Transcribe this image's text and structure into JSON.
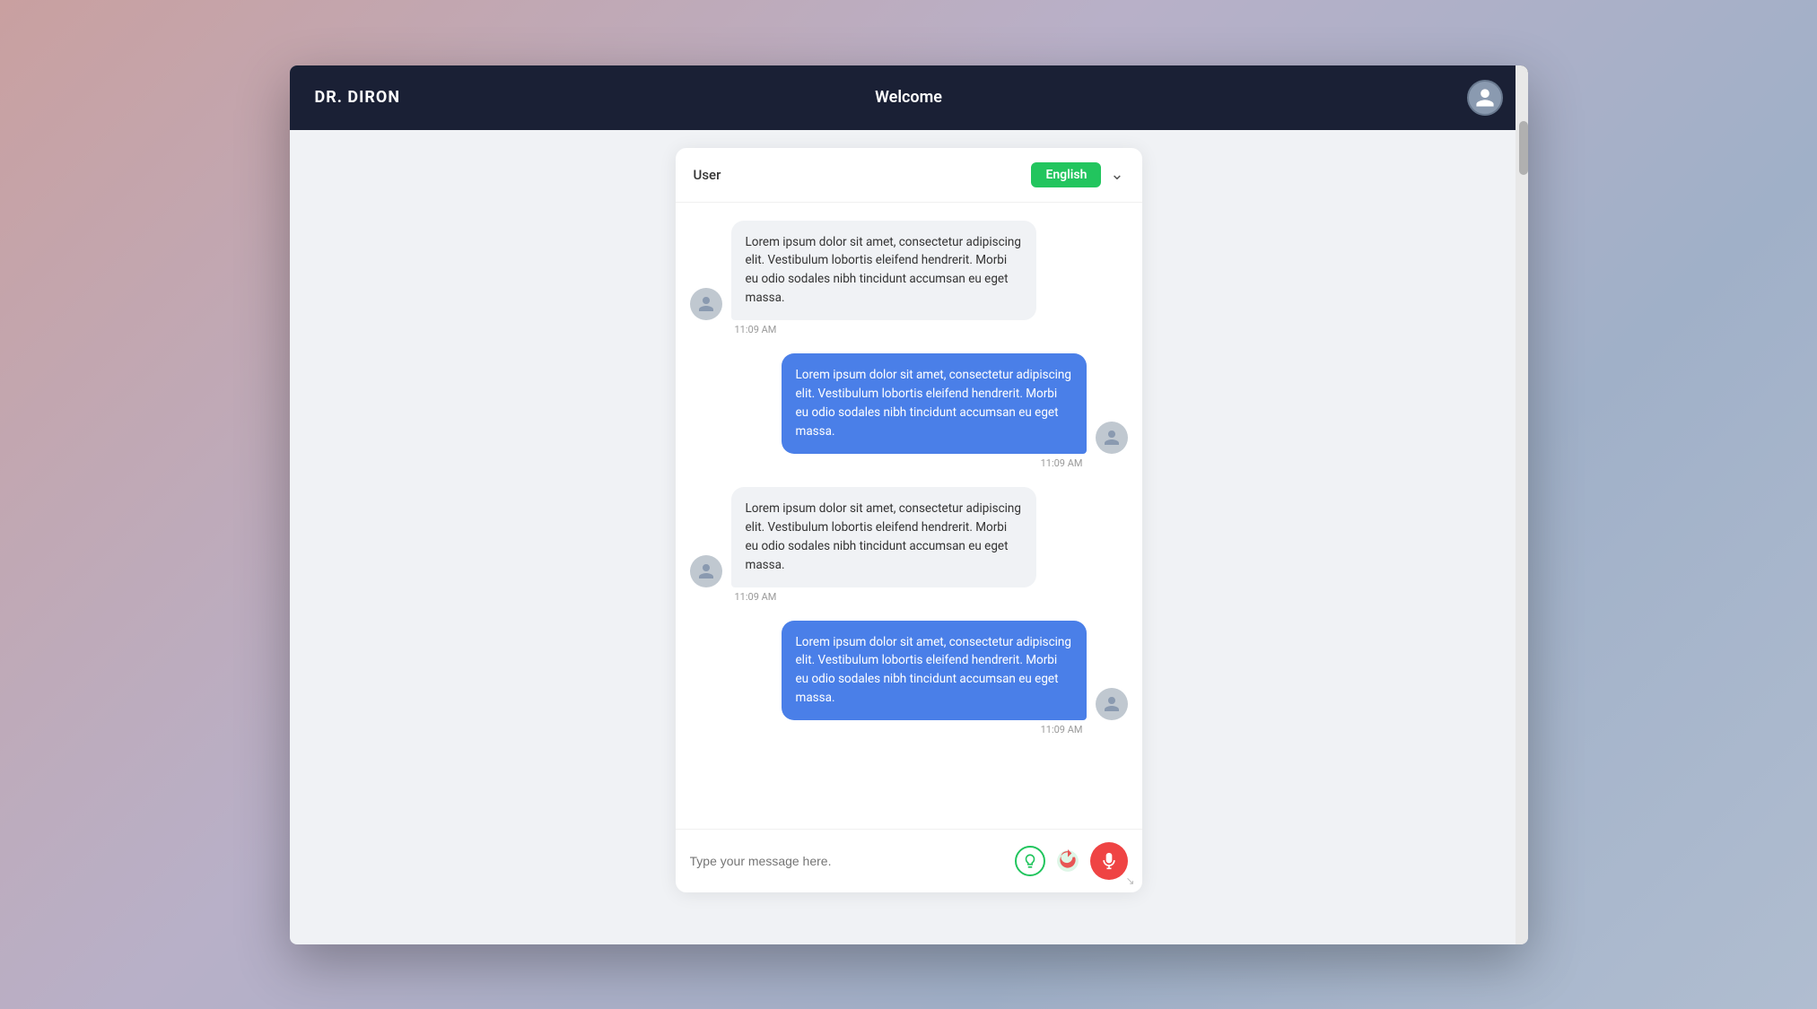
{
  "header": {
    "brand": "DR. DIRON",
    "title": "Welcome",
    "avatar_label": "user-avatar"
  },
  "chat": {
    "user_label": "User",
    "language_badge": "English",
    "messages": [
      {
        "id": 1,
        "type": "received",
        "text": "Lorem ipsum dolor sit amet, consectetur adipiscing elit. Vestibulum lobortis eleifend hendrerit. Morbi eu odio sodales nibh tincidunt accumsan eu eget massa.",
        "time": "11:09 AM"
      },
      {
        "id": 2,
        "type": "sent",
        "text": "Lorem ipsum dolor sit amet, consectetur adipiscing elit. Vestibulum lobortis eleifend hendrerit. Morbi eu odio sodales nibh tincidunt accumsan eu eget massa.",
        "time": "11:09 AM"
      },
      {
        "id": 3,
        "type": "received",
        "text": "Lorem ipsum dolor sit amet, consectetur adipiscing elit. Vestibulum lobortis eleifend hendrerit. Morbi eu odio sodales nibh tincidunt accumsan eu eget massa.",
        "time": "11:09 AM"
      },
      {
        "id": 4,
        "type": "sent",
        "text": "Lorem ipsum dolor sit amet, consectetur adipiscing elit. Vestibulum lobortis eleifend hendrerit. Morbi eu odio sodales nibh tincidunt accumsan eu eget massa.",
        "time": "11:09 AM"
      }
    ],
    "input_placeholder": "Type your message here.",
    "mic_button_label": "mic-button",
    "emoji_button_label": "emoji-button",
    "attachment_button_label": "attachment-button"
  }
}
